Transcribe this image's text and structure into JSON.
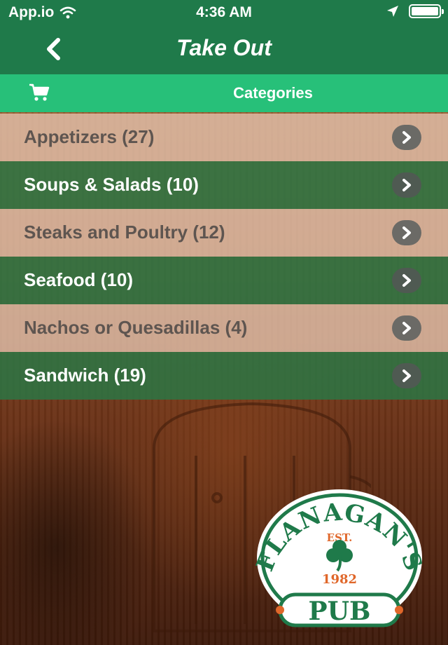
{
  "status": {
    "carrier": "App.io",
    "time": "4:36 AM"
  },
  "nav": {
    "title": "Take Out",
    "back_icon": "chevron-left-icon"
  },
  "subbar": {
    "title": "Categories",
    "cart_icon": "shopping-cart-icon"
  },
  "categories": [
    {
      "label": "Appetizers (27)"
    },
    {
      "label": "Soups & Salads (10)"
    },
    {
      "label": "Steaks and Poultry (12)"
    },
    {
      "label": "Seafood (10)"
    },
    {
      "label": "Nachos or Quesadillas (4)"
    },
    {
      "label": "Sandwich (19)"
    }
  ],
  "logo": {
    "name_top": "FLANAGAN'S",
    "est": "EST.",
    "year": "1982",
    "name_bottom": "PUB"
  },
  "colors": {
    "nav_green": "#1f7a4a",
    "subbar_green": "#27c079",
    "logo_orange": "#e0672a"
  }
}
